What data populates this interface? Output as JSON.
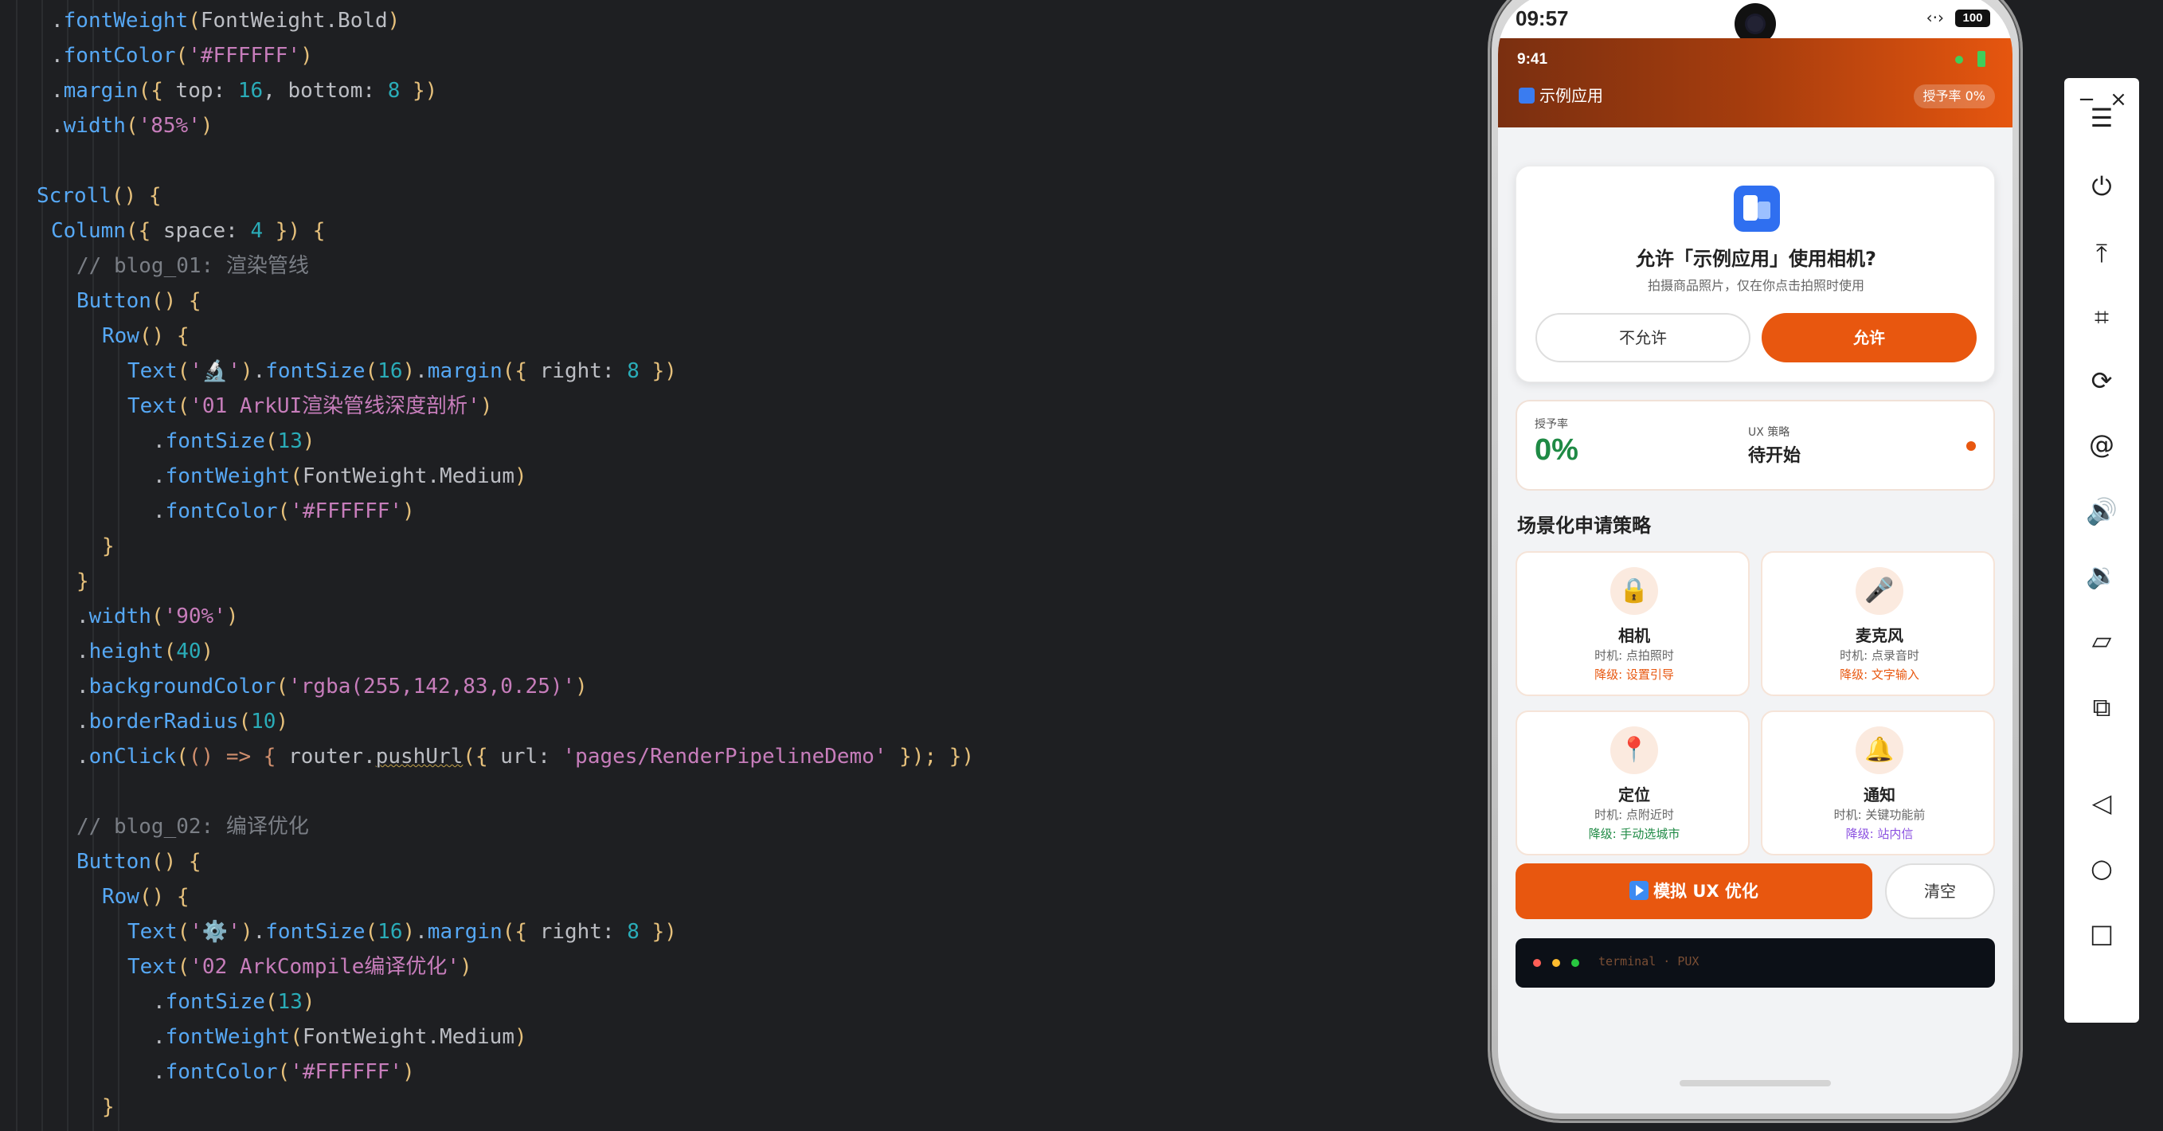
{
  "editor": {
    "lines": [
      {
        "indent": 2,
        "tokens": [
          {
            "t": ".",
            "c": "p"
          },
          {
            "t": "fontWeight",
            "c": "m"
          },
          {
            "t": "(",
            "c": "b"
          },
          {
            "t": "FontWeight.Bold",
            "c": "p"
          },
          {
            "t": ")",
            "c": "b"
          }
        ]
      },
      {
        "indent": 2,
        "tokens": [
          {
            "t": ".",
            "c": "p"
          },
          {
            "t": "fontColor",
            "c": "m"
          },
          {
            "t": "(",
            "c": "b"
          },
          {
            "t": "'#FFFFFF'",
            "c": "f"
          },
          {
            "t": ")",
            "c": "b"
          }
        ]
      },
      {
        "indent": 2,
        "tokens": [
          {
            "t": ".",
            "c": "p"
          },
          {
            "t": "margin",
            "c": "m"
          },
          {
            "t": "(",
            "c": "b"
          },
          {
            "t": "{ ",
            "c": "b"
          },
          {
            "t": "top: ",
            "c": "p"
          },
          {
            "t": "16",
            "c": "n"
          },
          {
            "t": ", bottom: ",
            "c": "p"
          },
          {
            "t": "8",
            "c": "n"
          },
          {
            "t": " }",
            "c": "b"
          },
          {
            "t": ")",
            "c": "b"
          }
        ]
      },
      {
        "indent": 2,
        "tokens": [
          {
            "t": ".",
            "c": "p"
          },
          {
            "t": "width",
            "c": "m"
          },
          {
            "t": "(",
            "c": "b"
          },
          {
            "t": "'85%'",
            "c": "f"
          },
          {
            "t": ")",
            "c": "b"
          }
        ]
      },
      {
        "indent": 0,
        "tokens": []
      },
      {
        "indent": 1,
        "tokens": [
          {
            "t": "Scroll",
            "c": "m"
          },
          {
            "t": "() {",
            "c": "b"
          }
        ]
      },
      {
        "indent": 2,
        "tokens": [
          {
            "t": "Column",
            "c": "m"
          },
          {
            "t": "(",
            "c": "b"
          },
          {
            "t": "{ ",
            "c": "b"
          },
          {
            "t": "space: ",
            "c": "p"
          },
          {
            "t": "4",
            "c": "n"
          },
          {
            "t": " }",
            "c": "b"
          },
          {
            "t": ") {",
            "c": "b"
          }
        ]
      },
      {
        "indent": 3,
        "tokens": [
          {
            "t": "// blog_01: 渲染管线",
            "c": "c"
          }
        ]
      },
      {
        "indent": 3,
        "tokens": [
          {
            "t": "Button",
            "c": "m"
          },
          {
            "t": "() {",
            "c": "b"
          }
        ]
      },
      {
        "indent": 4,
        "tokens": [
          {
            "t": "Row",
            "c": "m"
          },
          {
            "t": "() {",
            "c": "b"
          }
        ]
      },
      {
        "indent": 5,
        "tokens": [
          {
            "t": "Text",
            "c": "m"
          },
          {
            "t": "(",
            "c": "b"
          },
          {
            "t": "'🔬'",
            "c": "f"
          },
          {
            "t": ")",
            "c": "b"
          },
          {
            "t": ".",
            "c": "p"
          },
          {
            "t": "fontSize",
            "c": "m"
          },
          {
            "t": "(",
            "c": "b"
          },
          {
            "t": "16",
            "c": "n"
          },
          {
            "t": ")",
            "c": "b"
          },
          {
            "t": ".",
            "c": "p"
          },
          {
            "t": "margin",
            "c": "m"
          },
          {
            "t": "(",
            "c": "b"
          },
          {
            "t": "{ ",
            "c": "b"
          },
          {
            "t": "right: ",
            "c": "p"
          },
          {
            "t": "8",
            "c": "n"
          },
          {
            "t": " }",
            "c": "b"
          },
          {
            "t": ")",
            "c": "b"
          }
        ]
      },
      {
        "indent": 5,
        "tokens": [
          {
            "t": "Text",
            "c": "m"
          },
          {
            "t": "(",
            "c": "b"
          },
          {
            "t": "'01 ArkUI渲染管线深度剖析'",
            "c": "f"
          },
          {
            "t": ")",
            "c": "b"
          }
        ]
      },
      {
        "indent": 6,
        "tokens": [
          {
            "t": ".",
            "c": "p"
          },
          {
            "t": "fontSize",
            "c": "m"
          },
          {
            "t": "(",
            "c": "b"
          },
          {
            "t": "13",
            "c": "n"
          },
          {
            "t": ")",
            "c": "b"
          }
        ]
      },
      {
        "indent": 6,
        "tokens": [
          {
            "t": ".",
            "c": "p"
          },
          {
            "t": "fontWeight",
            "c": "m"
          },
          {
            "t": "(",
            "c": "b"
          },
          {
            "t": "FontWeight.Medium",
            "c": "p"
          },
          {
            "t": ")",
            "c": "b"
          }
        ]
      },
      {
        "indent": 6,
        "tokens": [
          {
            "t": ".",
            "c": "p"
          },
          {
            "t": "fontColor",
            "c": "m"
          },
          {
            "t": "(",
            "c": "b"
          },
          {
            "t": "'#FFFFFF'",
            "c": "f"
          },
          {
            "t": ")",
            "c": "b"
          }
        ]
      },
      {
        "indent": 4,
        "tokens": [
          {
            "t": "}",
            "c": "b"
          }
        ]
      },
      {
        "indent": 3,
        "tokens": [
          {
            "t": "}",
            "c": "b"
          }
        ]
      },
      {
        "indent": 3,
        "tokens": [
          {
            "t": ".",
            "c": "p"
          },
          {
            "t": "width",
            "c": "m"
          },
          {
            "t": "(",
            "c": "b"
          },
          {
            "t": "'90%'",
            "c": "f"
          },
          {
            "t": ")",
            "c": "b"
          }
        ]
      },
      {
        "indent": 3,
        "tokens": [
          {
            "t": ".",
            "c": "p"
          },
          {
            "t": "height",
            "c": "m"
          },
          {
            "t": "(",
            "c": "b"
          },
          {
            "t": "40",
            "c": "n"
          },
          {
            "t": ")",
            "c": "b"
          }
        ]
      },
      {
        "indent": 3,
        "tokens": [
          {
            "t": ".",
            "c": "p"
          },
          {
            "t": "backgroundColor",
            "c": "m"
          },
          {
            "t": "(",
            "c": "b"
          },
          {
            "t": "'rgba(255,142,83,0.25)'",
            "c": "f"
          },
          {
            "t": ")",
            "c": "b"
          }
        ]
      },
      {
        "indent": 3,
        "tokens": [
          {
            "t": ".",
            "c": "p"
          },
          {
            "t": "borderRadius",
            "c": "m"
          },
          {
            "t": "(",
            "c": "b"
          },
          {
            "t": "10",
            "c": "n"
          },
          {
            "t": ")",
            "c": "b"
          }
        ]
      },
      {
        "indent": 3,
        "tokens": [
          {
            "t": ".",
            "c": "p"
          },
          {
            "t": "onClick",
            "c": "m"
          },
          {
            "t": "(",
            "c": "b"
          },
          {
            "t": "() => { ",
            "c": "k"
          },
          {
            "t": "router.",
            "c": "p"
          },
          {
            "t": "pushUrl",
            "c": "u"
          },
          {
            "t": "(",
            "c": "b"
          },
          {
            "t": "{ ",
            "c": "b"
          },
          {
            "t": "url: ",
            "c": "p"
          },
          {
            "t": "'pages/RenderPipelineDemo'",
            "c": "f"
          },
          {
            "t": " }",
            "c": "b"
          },
          {
            "t": "); })",
            "c": "b"
          }
        ]
      },
      {
        "indent": 0,
        "tokens": []
      },
      {
        "indent": 3,
        "tokens": [
          {
            "t": "// blog_02: 编译优化",
            "c": "c"
          }
        ]
      },
      {
        "indent": 3,
        "tokens": [
          {
            "t": "Button",
            "c": "m"
          },
          {
            "t": "() {",
            "c": "b"
          }
        ]
      },
      {
        "indent": 4,
        "tokens": [
          {
            "t": "Row",
            "c": "m"
          },
          {
            "t": "() {",
            "c": "b"
          }
        ]
      },
      {
        "indent": 5,
        "tokens": [
          {
            "t": "Text",
            "c": "m"
          },
          {
            "t": "(",
            "c": "b"
          },
          {
            "t": "'⚙️'",
            "c": "f"
          },
          {
            "t": ")",
            "c": "b"
          },
          {
            "t": ".",
            "c": "p"
          },
          {
            "t": "fontSize",
            "c": "m"
          },
          {
            "t": "(",
            "c": "b"
          },
          {
            "t": "16",
            "c": "n"
          },
          {
            "t": ")",
            "c": "b"
          },
          {
            "t": ".",
            "c": "p"
          },
          {
            "t": "margin",
            "c": "m"
          },
          {
            "t": "(",
            "c": "b"
          },
          {
            "t": "{ ",
            "c": "b"
          },
          {
            "t": "right: ",
            "c": "p"
          },
          {
            "t": "8",
            "c": "n"
          },
          {
            "t": " }",
            "c": "b"
          },
          {
            "t": ")",
            "c": "b"
          }
        ]
      },
      {
        "indent": 5,
        "tokens": [
          {
            "t": "Text",
            "c": "m"
          },
          {
            "t": "(",
            "c": "b"
          },
          {
            "t": "'02 ArkCompile编译优化'",
            "c": "f"
          },
          {
            "t": ")",
            "c": "b"
          }
        ]
      },
      {
        "indent": 6,
        "tokens": [
          {
            "t": ".",
            "c": "p"
          },
          {
            "t": "fontSize",
            "c": "m"
          },
          {
            "t": "(",
            "c": "b"
          },
          {
            "t": "13",
            "c": "n"
          },
          {
            "t": ")",
            "c": "b"
          }
        ]
      },
      {
        "indent": 6,
        "tokens": [
          {
            "t": ".",
            "c": "p"
          },
          {
            "t": "fontWeight",
            "c": "m"
          },
          {
            "t": "(",
            "c": "b"
          },
          {
            "t": "FontWeight.Medium",
            "c": "p"
          },
          {
            "t": ")",
            "c": "b"
          }
        ]
      },
      {
        "indent": 6,
        "tokens": [
          {
            "t": ".",
            "c": "p"
          },
          {
            "t": "fontColor",
            "c": "m"
          },
          {
            "t": "(",
            "c": "b"
          },
          {
            "t": "'#FFFFFF'",
            "c": "f"
          },
          {
            "t": ")",
            "c": "b"
          }
        ]
      },
      {
        "indent": 4,
        "tokens": [
          {
            "t": "}",
            "c": "b"
          }
        ]
      }
    ]
  },
  "phone": {
    "status_time": "09:57",
    "status_icons": "‹·›",
    "battery": "100",
    "header": {
      "time": "9:41",
      "app_name": "示例应用",
      "badge": "授予率 0%"
    },
    "permission_dialog": {
      "title": "允许「示例应用」使用相机?",
      "description": "拍摄商品照片，仅在你点击拍照时使用",
      "deny_label": "不允许",
      "allow_label": "允许"
    },
    "stats": {
      "grant_label": "授予率",
      "grant_value": "0%",
      "strategy_label": "UX 策略",
      "strategy_value": "待开始"
    },
    "section_title": "场景化申请策略",
    "tiles": [
      {
        "icon": "camera-icon",
        "glyph": "🔒",
        "name": "相机",
        "when": "时机: 点拍照时",
        "fallback": "降级: 设置引导",
        "fallback_color": "#e8570f"
      },
      {
        "icon": "microphone-icon",
        "glyph": "🎤",
        "name": "麦克风",
        "when": "时机: 点录音时",
        "fallback": "降级: 文字输入",
        "fallback_color": "#e8570f"
      },
      {
        "icon": "location-pin-icon",
        "glyph": "📍",
        "name": "定位",
        "when": "时机: 点附近时",
        "fallback": "降级: 手动选城市",
        "fallback_color": "#1f8a45"
      },
      {
        "icon": "bell-icon",
        "glyph": "🔔",
        "name": "通知",
        "when": "时机: 关键功能前",
        "fallback": "降级: 站内信",
        "fallback_color": "#8a4fe0"
      }
    ],
    "simulate_label": "模拟 UX 优化",
    "clear_label": "清空",
    "terminal_label": "terminal · PUX"
  },
  "toolbar": {
    "minimize_glyph": "−",
    "close_glyph": "×",
    "items": [
      {
        "name": "menu-icon",
        "glyph": "☰"
      },
      {
        "name": "power-icon",
        "glyph": "⏻"
      },
      {
        "name": "pin-top-icon",
        "glyph": "⤒"
      },
      {
        "name": "crop-icon",
        "glyph": "⌗"
      },
      {
        "name": "rotate-icon",
        "glyph": "⟳"
      },
      {
        "name": "at-icon",
        "glyph": "@"
      },
      {
        "name": "volume-up-icon",
        "glyph": "🔊"
      },
      {
        "name": "volume-down-icon",
        "glyph": "🔉"
      },
      {
        "name": "shake-icon",
        "glyph": "▱"
      },
      {
        "name": "multi-screen-icon",
        "glyph": "⧉"
      },
      {
        "name": "back-icon",
        "glyph": "◁"
      },
      {
        "name": "home-icon",
        "glyph": "○"
      },
      {
        "name": "recents-icon",
        "glyph": "□"
      }
    ]
  }
}
